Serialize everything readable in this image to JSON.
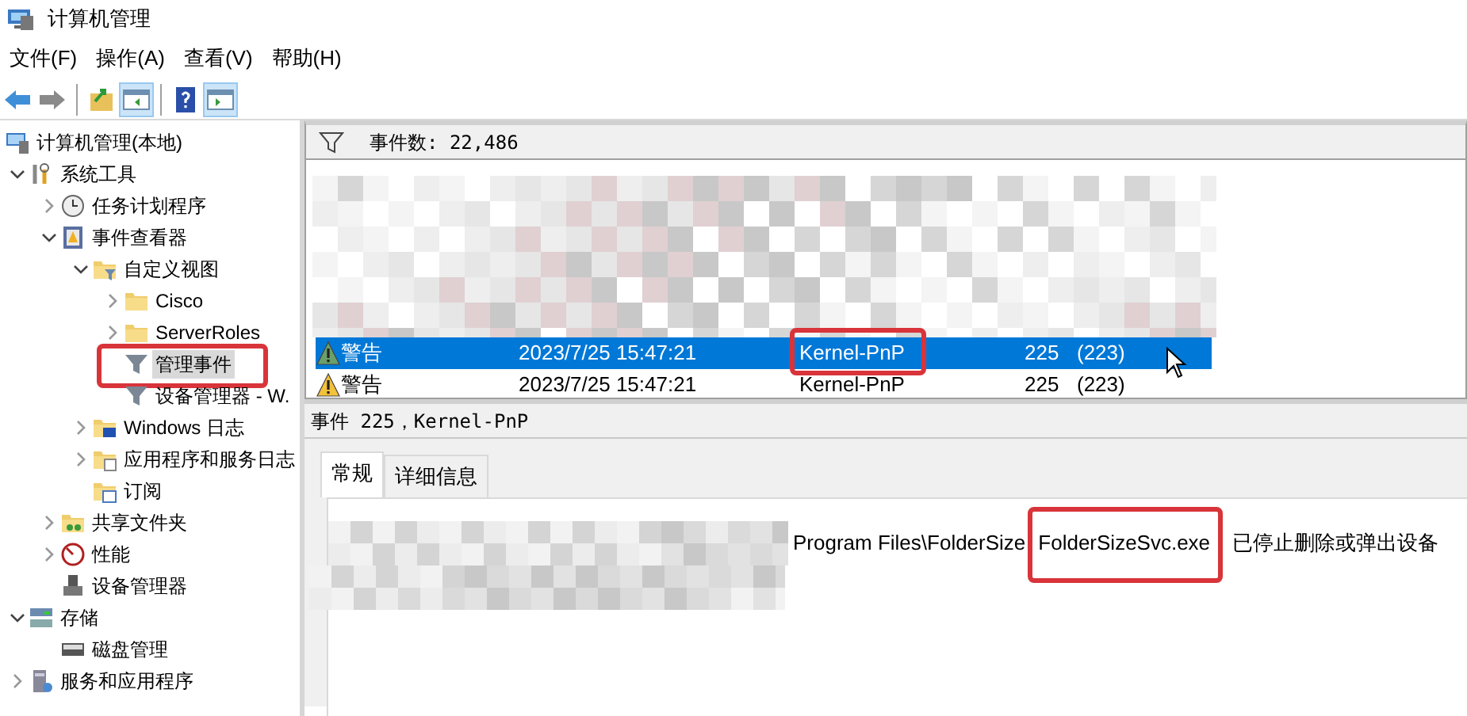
{
  "window": {
    "title": "计算机管理"
  },
  "menu": [
    "文件(F)",
    "操作(A)",
    "查看(V)",
    "帮助(H)"
  ],
  "toolbar": [
    {
      "kind": "back",
      "pressed": false
    },
    {
      "kind": "forward",
      "pressed": false
    },
    {
      "kind": "sep"
    },
    {
      "kind": "up",
      "pressed": false
    },
    {
      "kind": "tree",
      "pressed": true
    },
    {
      "kind": "sep"
    },
    {
      "kind": "help",
      "pressed": false
    },
    {
      "kind": "action",
      "pressed": true
    }
  ],
  "tree": [
    {
      "label": "计算机管理(本地)",
      "kind": "computer",
      "selected": false,
      "children": [
        {
          "label": "系统工具",
          "kind": "tools",
          "expanded": true,
          "selected": false,
          "children": [
            {
              "label": "任务计划程序",
              "kind": "clock",
              "expanded": false,
              "selected": false
            },
            {
              "label": "事件查看器",
              "kind": "eventviewer",
              "expanded": true,
              "selected": false,
              "children": [
                {
                  "label": "自定义视图",
                  "kind": "folder-filter",
                  "expanded": true,
                  "selected": false,
                  "children": [
                    {
                      "label": "Cisco",
                      "kind": "folder",
                      "expanded": false,
                      "selected": false
                    },
                    {
                      "label": "ServerRoles",
                      "kind": "folder",
                      "expanded": false,
                      "selected": false
                    },
                    {
                      "label": "管理事件",
                      "kind": "filter",
                      "selected": true,
                      "annotated": true
                    },
                    {
                      "label": "设备管理器 - W.",
                      "kind": "filter",
                      "selected": false
                    }
                  ]
                },
                {
                  "label": "Windows 日志",
                  "kind": "folder-windows",
                  "expanded": false,
                  "selected": false
                },
                {
                  "label": "应用程序和服务日志",
                  "kind": "folder-app",
                  "expanded": false,
                  "selected": false
                },
                {
                  "label": "订阅",
                  "kind": "subscription",
                  "selected": false
                }
              ]
            },
            {
              "label": "共享文件夹",
              "kind": "share",
              "expanded": false,
              "selected": false
            },
            {
              "label": "性能",
              "kind": "performance",
              "expanded": false,
              "selected": false
            },
            {
              "label": "设备管理器",
              "kind": "device",
              "selected": false
            }
          ]
        },
        {
          "label": "存储",
          "kind": "storage",
          "expanded": true,
          "selected": false,
          "children": [
            {
              "label": "磁盘管理",
              "kind": "disk",
              "selected": false
            }
          ]
        },
        {
          "label": "服务和应用程序",
          "kind": "services",
          "expanded": false,
          "selected": false
        }
      ]
    }
  ],
  "event_list": {
    "count": "事件数: 22,486",
    "rows": [
      {
        "kind": "warning",
        "level": "警告",
        "date": "2023/7/25 15:47:21",
        "source": "Kernel-PnP",
        "event_id": "225",
        "category": "(223)",
        "selected": true,
        "source_annotated": true
      },
      {
        "kind": "warning",
        "level": "警告",
        "date": "2023/7/25 15:47:21",
        "source": "Kernel-PnP",
        "event_id": "225",
        "category": "(223)",
        "selected": false,
        "source_annotated": false
      }
    ]
  },
  "detail": {
    "title": "事件 225，Kernel-PnP",
    "tabs": [
      {
        "label": "常规",
        "selected": true
      },
      {
        "label": "详细信息",
        "selected": false
      }
    ],
    "description": [
      {
        "text": "Program Files\\FolderSize",
        "annotated": false
      },
      {
        "text": "FolderSizeSvc.exe",
        "annotated": true
      },
      {
        "text": "已停止删除或弹出设备",
        "annotated": false
      }
    ]
  }
}
